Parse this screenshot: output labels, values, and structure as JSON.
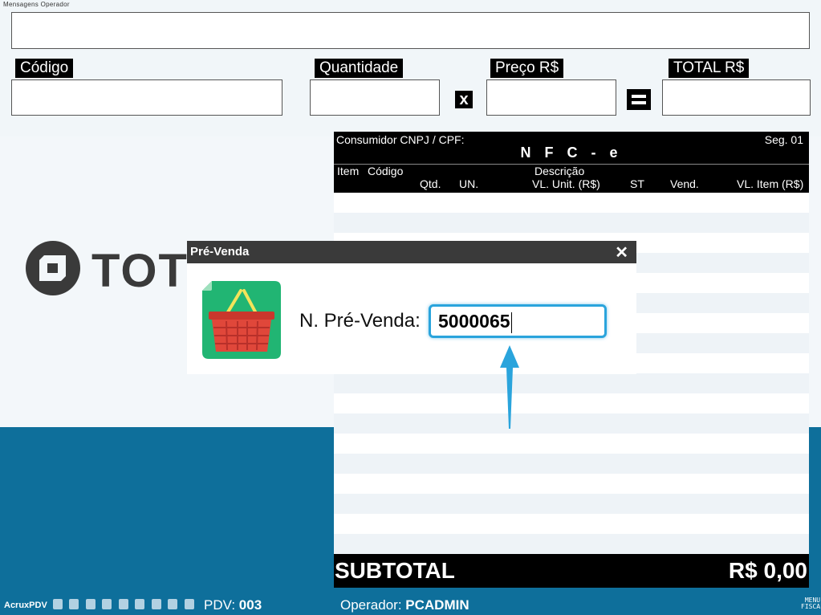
{
  "header": {
    "caption": "Mensagens Operador",
    "fields": {
      "codigo_label": "Código",
      "quantidade_label": "Quantidade",
      "preco_label": "Preço R$",
      "total_label": "TOTAL R$",
      "times_symbol": "x"
    }
  },
  "logo": {
    "text": "TOTVS"
  },
  "receipt": {
    "consumer_label": "Consumidor CNPJ / CPF:",
    "segment": "Seg. 01",
    "title": "N F C - e",
    "columns": {
      "item": "Item",
      "codigo": "Código",
      "descricao": "Descrição",
      "qtd": "Qtd.",
      "un": "UN.",
      "vl_unit": "VL. Unit. (R$)",
      "st": "ST",
      "vend": "Vend.",
      "vl_item": "VL. Item (R$)"
    },
    "subtotal_label": "SUBTOTAL",
    "subtotal_value": "R$ 0,00"
  },
  "dialog": {
    "title": "Pré-Venda",
    "close": "✕",
    "field_label": "N. Pré-Venda:",
    "field_value": "5000065"
  },
  "statusbar": {
    "app_name": "AcruxPDV",
    "pdv_label": "PDV:",
    "pdv_value": "003",
    "operator_label": "Operador:",
    "operator_value": "PCADMIN",
    "menu_line1": "MENU",
    "menu_line2": "FISCAL"
  },
  "colors": {
    "accent_blue": "#2aa4dc",
    "bottom_band": "#0e6f9b",
    "basket_green": "#21b573",
    "basket_red": "#e0473a"
  }
}
